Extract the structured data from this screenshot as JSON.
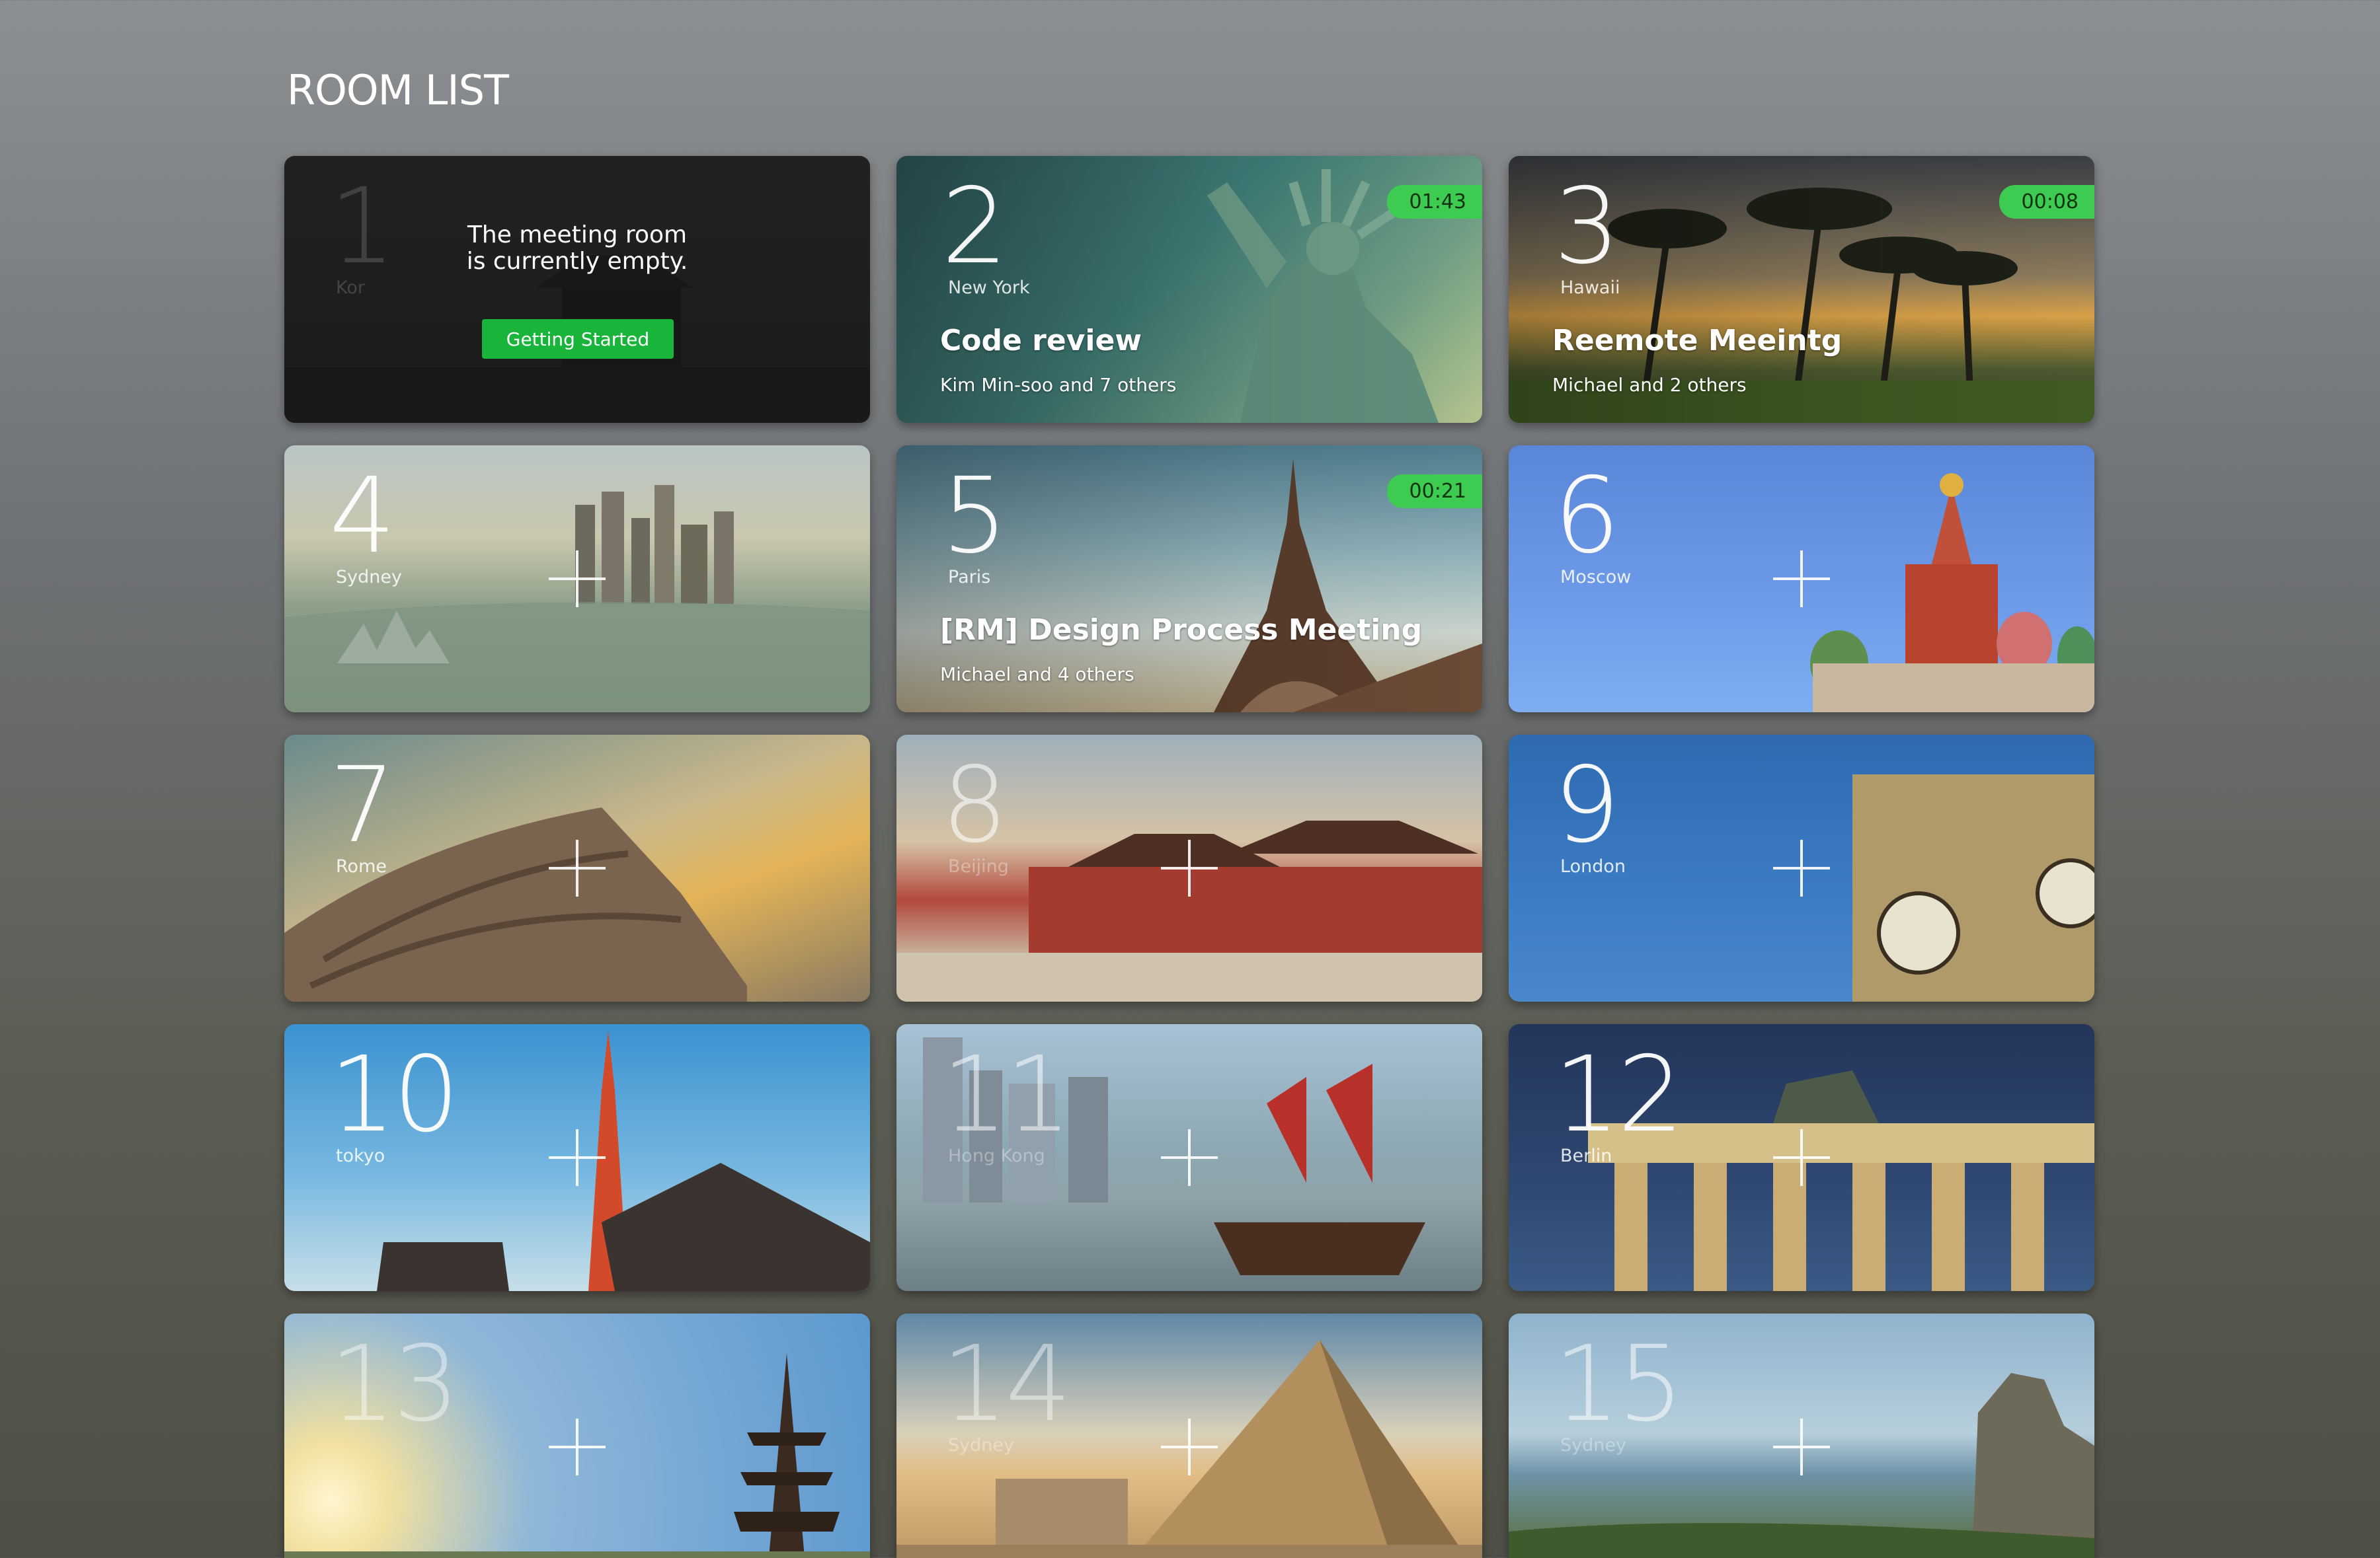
{
  "page": {
    "title": "ROOM LIST"
  },
  "colors": {
    "accent_green": "#3ecb52",
    "button_green": "#19b43a"
  },
  "rooms": [
    {
      "number": "1",
      "city": "Kor",
      "state": "empty",
      "empty_message_line1": "The meeting room",
      "empty_message_line2": "is currently empty.",
      "button_label": "Getting Started"
    },
    {
      "number": "2",
      "city": "New York",
      "state": "active",
      "timer": "01:43",
      "meeting_title": "Code review",
      "members": "Kim Min-soo and 7 others"
    },
    {
      "number": "3",
      "city": "Hawaii",
      "state": "active",
      "timer": "00:08",
      "meeting_title": "Reemote Meeintg",
      "members": "Michael and 2 others"
    },
    {
      "number": "4",
      "city": "Sydney",
      "state": "available"
    },
    {
      "number": "5",
      "city": "Paris",
      "state": "active",
      "timer": "00:21",
      "meeting_title": "[RM] Design Process Meeting",
      "members": "Michael and 4 others"
    },
    {
      "number": "6",
      "city": "Moscow",
      "state": "available"
    },
    {
      "number": "7",
      "city": "Rome",
      "state": "available"
    },
    {
      "number": "8",
      "city": "Beijing",
      "state": "available"
    },
    {
      "number": "9",
      "city": "London",
      "state": "available"
    },
    {
      "number": "10",
      "city": "tokyo",
      "state": "available"
    },
    {
      "number": "11",
      "city": "Hong Kong",
      "state": "available"
    },
    {
      "number": "12",
      "city": "Berlin",
      "state": "available"
    },
    {
      "number": "13",
      "city": "",
      "state": "available"
    },
    {
      "number": "14",
      "city": "Sydney",
      "state": "available"
    },
    {
      "number": "15",
      "city": "Sydney",
      "state": "available"
    }
  ]
}
